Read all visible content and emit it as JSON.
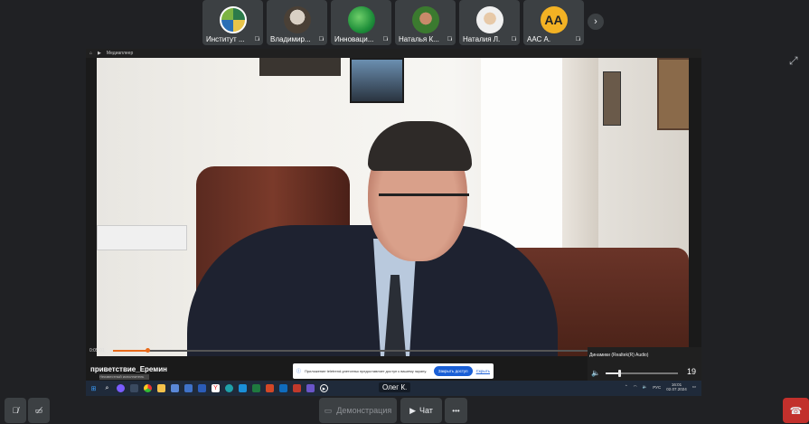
{
  "participants": [
    {
      "name": "Институт ...",
      "avatar": "logo"
    },
    {
      "name": "Владимир...",
      "avatar": "photo"
    },
    {
      "name": "Инноваци...",
      "avatar": "green-globe"
    },
    {
      "name": "Наталья К...",
      "avatar": "photo"
    },
    {
      "name": "Наталия Л.",
      "avatar": "photo"
    },
    {
      "name": "ААС А.",
      "avatar": "initials",
      "initials": "AA"
    }
  ],
  "next_glyph": "›",
  "share": {
    "app_title": "Медиаплеер",
    "current_time": "0:05:01",
    "progress_fraction": 0.06,
    "media_title": "приветствие_Еремин",
    "media_subtitle": "Неизвестный исполнитель",
    "notification": {
      "text": "Приложение teletrend-уиетсеньк предоставляет доступ к вашему экрану.",
      "action": "Закрыть доступ",
      "cancel": "Скрыть"
    },
    "audio": {
      "device": "Динамики (Realtek(R) Audio)",
      "volume": "19",
      "volume_fraction": 0.19
    },
    "tray": {
      "lang": "РУС",
      "time": "16:01",
      "date": "02.07.2024"
    }
  },
  "speaker_name": "Олег К.",
  "controls": {
    "demo_label": "Демонстрация",
    "chat_label": "Чат",
    "more_label": "•••"
  }
}
